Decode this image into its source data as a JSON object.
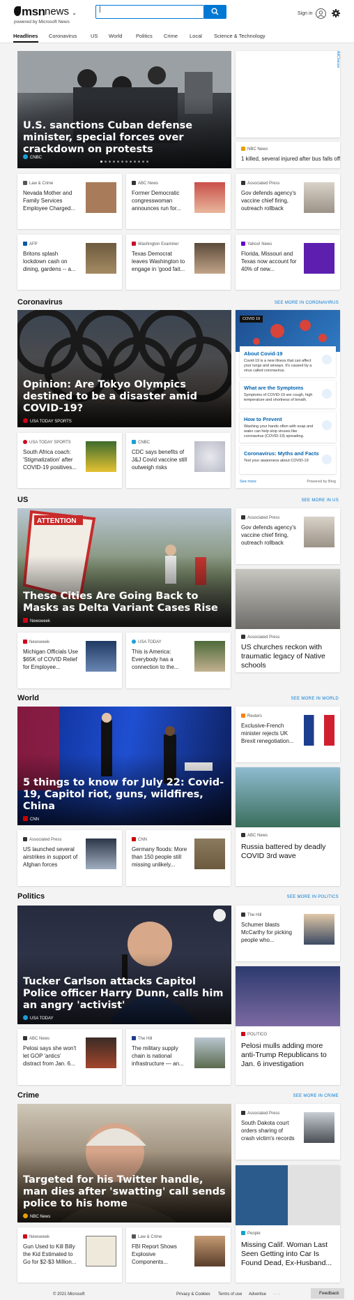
{
  "header": {
    "brand": "msn",
    "section": "news",
    "powered": "powered by Microsoft News",
    "search_value": "|",
    "signin": "Sign in"
  },
  "nav": [
    "Headlines",
    "Coronavirus",
    "US",
    "World",
    "Politics",
    "Crime",
    "Local",
    "Science & Technology"
  ],
  "ad_label": "AdChoices",
  "top": {
    "hero": {
      "title": "U.S. sanctions Cuban defense minister, special forces over crackdown on protests",
      "source": "CNBC"
    },
    "side": {
      "source": "NBC News",
      "title": "1 killed, several injured after bus falls off..."
    },
    "row1": [
      {
        "source": "Law & Crime",
        "title": "Nevada Mother and Family Services Employee Charged..."
      },
      {
        "source": "ABC News",
        "title": "Former Democratic congresswoman announces run for..."
      },
      {
        "source": "Associated Press",
        "title": "Gov defends agency's vaccine chief firing, outreach rollback"
      }
    ],
    "row2": [
      {
        "source": "AFP",
        "title": "Britons splash lockdown cash on dining, gardens -- a..."
      },
      {
        "source": "Washington Examiner",
        "title": "Texas Democrat leaves Washington to engage in 'good fait..."
      },
      {
        "source": "Yahoo! News",
        "title": "Florida, Missouri and Texas now account for 40% of new..."
      }
    ]
  },
  "coronavirus": {
    "heading": "Coronavirus",
    "see_more": "SEE MORE IN CORONAVIRUS",
    "hero": {
      "title": "Opinion: Are Tokyo Olympics destined to be a disaster amid COVID-19?",
      "source": "USA TODAY SPORTS"
    },
    "cards": [
      {
        "source": "USA TODAY SPORTS",
        "title": "South Africa coach: 'Stigmatization' after COVID-19 positives..."
      },
      {
        "source": "CNBC",
        "title": "CDC says benefits of J&J Covid vaccine still outweigh risks"
      }
    ],
    "panel": {
      "tag": "COVID 19",
      "items": [
        {
          "h": "About Covid-19",
          "d": "Covid-19 is a new illness that can affect your lungs and airways. It's caused by a virus called coronavirus."
        },
        {
          "h": "What are the Symptoms",
          "d": "Symptoms of COVID-19 are cough, high temperature and shortness of breath."
        },
        {
          "h": "How to Prevent",
          "d": "Washing your hands often with soap and water can help stop viruses like coronavirus (COVID-19) spreading."
        },
        {
          "h": "Coronavirus: Myths and Facts",
          "d": "Test your awareness about COVID-19"
        }
      ],
      "see_more": "See more",
      "powered": "Powered by Bing"
    }
  },
  "us": {
    "heading": "US",
    "see_more": "SEE MORE IN US",
    "hero": {
      "title": "These Cities Are Going Back to Masks as Delta Variant Cases Rise",
      "source": "Newsweek"
    },
    "side": {
      "source": "Associated Press",
      "title": "Gov defends agency's vaccine chief firing, outreach rollback"
    },
    "big": {
      "source": "Associated Press",
      "title": "US churches reckon with traumatic legacy of Native schools"
    },
    "cards": [
      {
        "source": "Newsweek",
        "title": "Michigan Officials Use $65K of COVID Relief for Employee..."
      },
      {
        "source": "USA TODAY",
        "title": "This is America: Everybody has a connection to the..."
      }
    ]
  },
  "world": {
    "heading": "World",
    "see_more": "SEE MORE IN WORLD",
    "hero": {
      "title": "5 things to know for July 22: Covid-19, Capitol riot, guns, wildfires, China",
      "source": "CNN"
    },
    "side": {
      "source": "Reuters",
      "title": "Exclusive-French minister rejects UK Brexit renegotiation..."
    },
    "big": {
      "source": "ABC News",
      "title": "Russia battered by deadly COVID 3rd wave"
    },
    "cards": [
      {
        "source": "Associated Press",
        "title": "US launched several airstrikes in support of Afghan forces"
      },
      {
        "source": "CNN",
        "title": "Germany floods: More than 150 people still missing unlikely..."
      }
    ]
  },
  "politics": {
    "heading": "Politics",
    "see_more": "SEE MORE IN POLITICS",
    "hero": {
      "title": "Tucker Carlson attacks Capitol Police officer Harry Dunn, calls him an angry 'activist'",
      "source": "USA TODAY"
    },
    "side": {
      "source": "The Hill",
      "title": "Schumer blasts McCarthy for picking people who..."
    },
    "big": {
      "source": "POLITICO",
      "title": "Pelosi mulls adding more anti-Trump Republicans to Jan. 6 investigation"
    },
    "cards": [
      {
        "source": "ABC News",
        "title": "Pelosi says she won't let GOP 'antics' distract from Jan. 6..."
      },
      {
        "source": "The Hill",
        "title": "The military supply chain is national infrastructure — an..."
      }
    ]
  },
  "crime": {
    "heading": "Crime",
    "see_more": "SEE MORE IN CRIME",
    "hero": {
      "title": "Targeted for his Twitter handle, man dies after 'swatting' call sends police to his home",
      "source": "NBC News"
    },
    "side": {
      "source": "Associated Press",
      "title": "South Dakota court orders sharing of crash victim's records"
    },
    "big": {
      "source": "People",
      "title": "Missing Calif. Woman Last Seen Getting into Car Is Found Dead, Ex-Husband..."
    },
    "cards": [
      {
        "source": "Newsweek",
        "title": "Gun Used to Kill Billy the Kid Estimated to Go for $2-$3 Million..."
      },
      {
        "source": "Law & Crime",
        "title": "FBI Report Shows Explosive Components..."
      }
    ]
  },
  "footer": {
    "copyright": "© 2021 Microsoft",
    "privacy": "Privacy & Cookies",
    "terms": "Terms of use",
    "advertise": "Advertise",
    "more": "· · ·",
    "feedback": "Feedback"
  }
}
